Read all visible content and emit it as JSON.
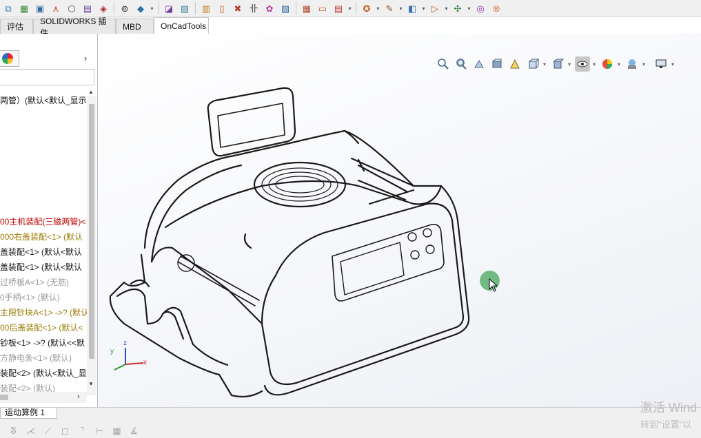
{
  "toolbar": {
    "icons": [
      {
        "name": "assembly-icon",
        "glyph": "⧉",
        "color": "#2f7fbf"
      },
      {
        "name": "insert-component-icon",
        "glyph": "▦",
        "color": "#3a8a3a"
      },
      {
        "name": "new-part-icon",
        "glyph": "▣",
        "color": "#2f6a9f"
      },
      {
        "name": "mate-icon",
        "glyph": "⋏",
        "color": "#c04020"
      },
      {
        "name": "smart-fasteners-icon",
        "glyph": "⬡",
        "color": "#555"
      },
      {
        "name": "linear-pattern-icon",
        "glyph": "▤",
        "color": "#6a4a9a"
      },
      {
        "name": "move-component-icon",
        "glyph": "◈",
        "color": "#a53030"
      },
      {
        "name": "show-hidden-icon",
        "glyph": "⊚",
        "color": "#2f2f2f"
      },
      {
        "name": "assembly-features-icon",
        "glyph": "◆",
        "color": "#2b6fa8"
      },
      {
        "name": "reference-geometry-icon",
        "glyph": "◪",
        "color": "#7a3fa0"
      },
      {
        "name": "new-motion-study-icon",
        "glyph": "▧",
        "color": "#3b8a9a"
      },
      {
        "name": "bill-of-materials-icon",
        "glyph": "▥",
        "color": "#c17a1b"
      },
      {
        "name": "exploded-view-icon",
        "glyph": "▯",
        "color": "#b8541b"
      },
      {
        "name": "instant3d-icon",
        "glyph": "✖",
        "color": "#b13a2b"
      },
      {
        "name": "interference-icon",
        "glyph": "卝",
        "color": "#333"
      },
      {
        "name": "assembly-visualization-icon",
        "glyph": "✿",
        "color": "#b83fa3"
      },
      {
        "name": "performance-evaluation-icon",
        "glyph": "▨",
        "color": "#2f6a9f"
      },
      {
        "name": "calendar-icon",
        "glyph": "▦",
        "color": "#b54a2b"
      },
      {
        "name": "instant-icon",
        "glyph": "▭",
        "color": "#b36a2b"
      },
      {
        "name": "hole-series-icon",
        "glyph": "▤",
        "color": "#c23a3a"
      },
      {
        "name": "gear-icon",
        "glyph": "✪",
        "color": "#c25a1b"
      },
      {
        "name": "pin-icon",
        "glyph": "✎",
        "color": "#8a5a2b"
      },
      {
        "name": "cube-icon",
        "glyph": "◧",
        "color": "#3a6fb0"
      },
      {
        "name": "play-icon",
        "glyph": "▷",
        "color": "#c25a1b"
      },
      {
        "name": "explode-icon",
        "glyph": "✣",
        "color": "#2f7a3b"
      },
      {
        "name": "target-icon",
        "glyph": "◎",
        "color": "#9b2fb0"
      },
      {
        "name": "registered-icon",
        "glyph": "®",
        "color": "#c25a1b"
      }
    ]
  },
  "tabs": [
    {
      "label": "评估",
      "active": false
    },
    {
      "label": "SOLIDWORKS 插件",
      "active": false
    },
    {
      "label": "MBD",
      "active": false
    },
    {
      "label": "OnCadTools",
      "active": true
    }
  ],
  "feature_tree": {
    "items": [
      {
        "label": "两管）(默认<默认_显示状",
        "color": "#111111"
      },
      {
        "label": "00主机装配(三磁两管)<",
        "color": "#c00000"
      },
      {
        "label": "000右盖装配<1> (默认",
        "color": "#9a7a00"
      },
      {
        "label": "盖装配<1> (默认<默认",
        "color": "#111111"
      },
      {
        "label": "盖装配<1> (默认<默认",
        "color": "#111111"
      },
      {
        "label": "过桥板A<1> (无筋)",
        "color": "#9a9a9a"
      },
      {
        "label": "0手柄<1> (默认)",
        "color": "#9a9a9a"
      },
      {
        "label": "主限钞块A<1> ->? (默认",
        "color": "#9a7a00"
      },
      {
        "label": "00后盖装配<1> (默认<",
        "color": "#9a7a00"
      },
      {
        "label": "钞板<1> ->? (默认<<默",
        "color": "#111111"
      },
      {
        "label": "方静电条<1> (默认)",
        "color": "#9a9a9a"
      },
      {
        "label": "装配<2> (默认<默认_显",
        "color": "#111111"
      },
      {
        "label": "装配<2> (默认)",
        "color": "#9a9a9a"
      }
    ]
  },
  "view_toolbar": {
    "icons": [
      "zoom-to-fit-icon",
      "zoom-to-area-icon",
      "previous-view-icon",
      "section-view-icon",
      "dynamic-annotation-icon",
      "view-orientation-icon",
      "display-style-icon",
      "hide-show-items-icon",
      "edit-appearance-icon",
      "apply-scene-icon",
      "view-settings-icon"
    ]
  },
  "bottom": {
    "tab_label": "运动算例 1"
  },
  "watermark": {
    "line1": "激活 Wind",
    "line2": "转到\"设置\"以"
  },
  "triad": {
    "x": "x",
    "y": "y",
    "z": "z"
  }
}
